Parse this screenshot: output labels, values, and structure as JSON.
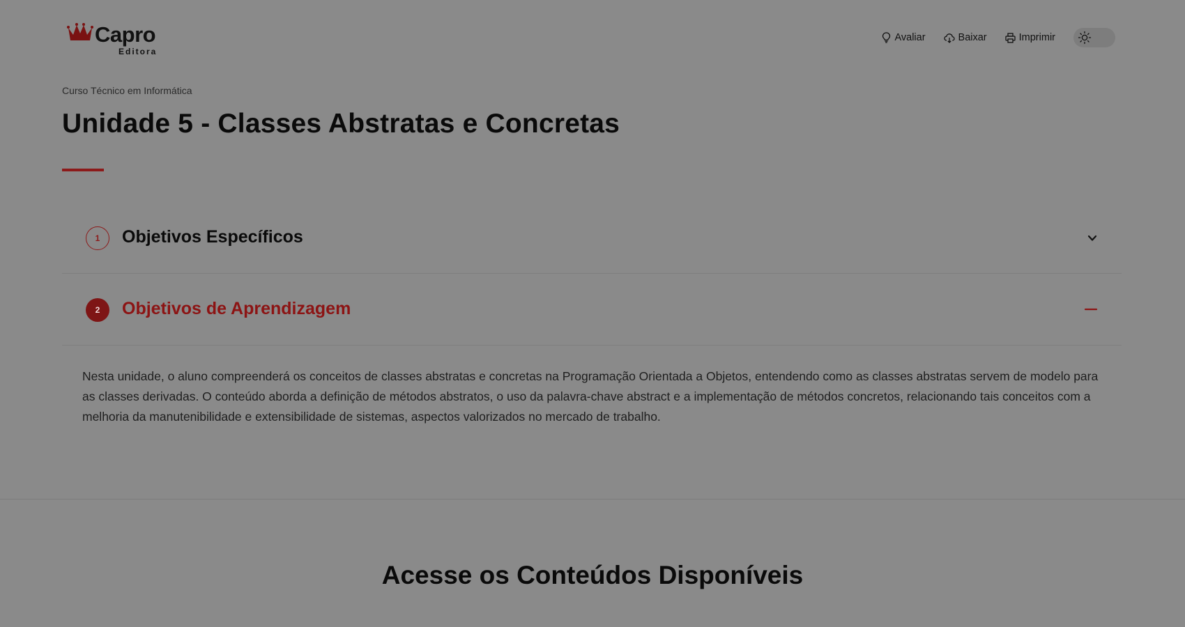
{
  "header": {
    "logo": {
      "name": "Capro",
      "sub": "Editora"
    },
    "actions": [
      {
        "label": "Avaliar",
        "icon": "lightbulb-icon"
      },
      {
        "label": "Baixar",
        "icon": "cloud-download-icon"
      },
      {
        "label": "Imprimir",
        "icon": "printer-icon"
      }
    ],
    "theme_toggle_icon": "sun-icon"
  },
  "breadcrumb": "Curso Técnico em Informática",
  "title": "Unidade 5 - Classes Abstratas e Concretas",
  "colors": {
    "accent": "#8c1a1a",
    "background": "#8a8a8a"
  },
  "accordion": [
    {
      "number": "1",
      "title": "Objetivos Específicos",
      "expanded": false,
      "toggle_icon": "chevron-down-icon"
    },
    {
      "number": "2",
      "title": "Objetivos de Aprendizagem",
      "expanded": true,
      "toggle_icon": "minus-icon",
      "body": "Nesta unidade, o aluno compreenderá os conceitos de classes abstratas e concretas na Programação Orientada a Objetos, entendendo como as classes abstratas servem de modelo para as classes derivadas. O conteúdo aborda a definição de métodos abstratos, o uso da palavra-chave abstract e a implementação de métodos concretos, relacionando tais conceitos com a melhoria da manutenibilidade e extensibilidade de sistemas, aspectos valorizados no mercado de trabalho."
    }
  ],
  "section": {
    "title": "Acesse os Conteúdos Disponíveis"
  }
}
